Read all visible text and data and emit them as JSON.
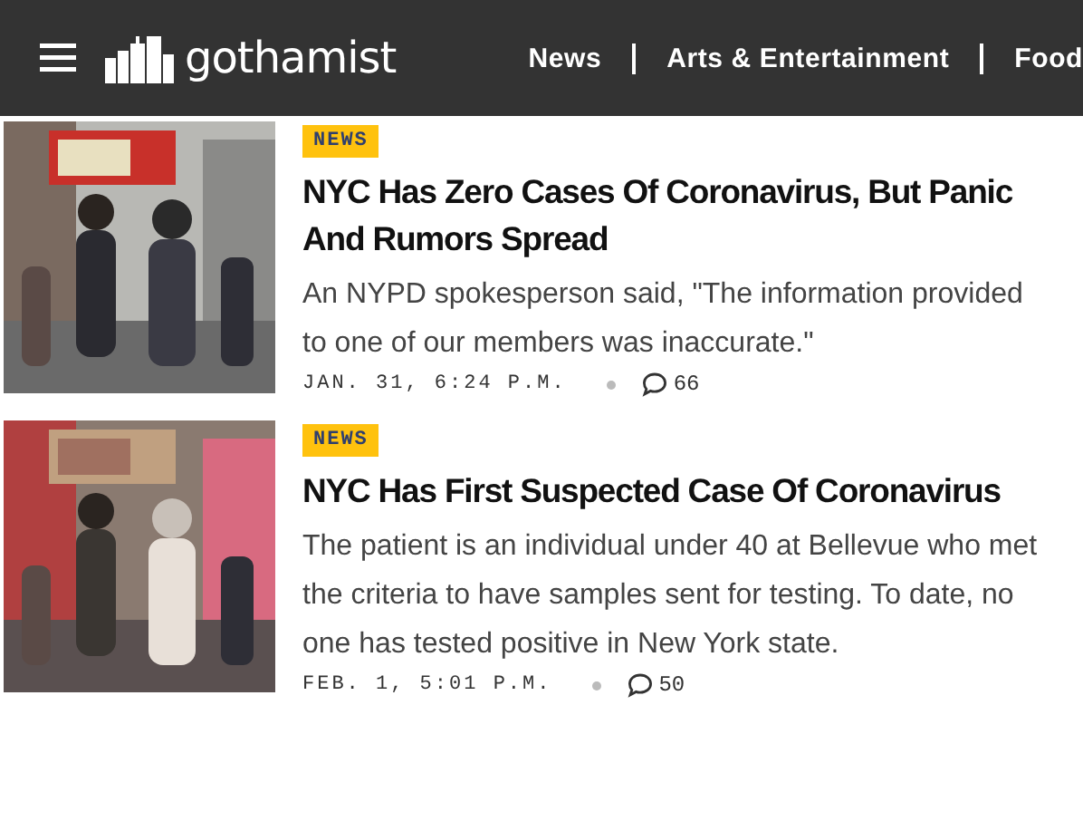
{
  "header": {
    "brand": "gothamist",
    "nav": [
      "News",
      "Arts & Entertainment",
      "Food"
    ]
  },
  "articles": [
    {
      "tag": "NEWS",
      "headline": "NYC Has Zero Cases Of Coronavirus, But Panic And Rumors Spread",
      "summary": "An NYPD spokesperson said, \"The information provided to one of our members was inaccurate.\"",
      "date": "JAN. 31, 6:24 P.M.",
      "comments": "66"
    },
    {
      "tag": "NEWS",
      "headline": "NYC Has First Suspected Case Of Coronavirus",
      "summary": "The patient is an individual under 40 at Bellevue who met the criteria to have samples sent for testing. To date, no one has tested positive in New York state.",
      "date": "FEB. 1, 5:01 P.M.",
      "comments": "50"
    }
  ]
}
